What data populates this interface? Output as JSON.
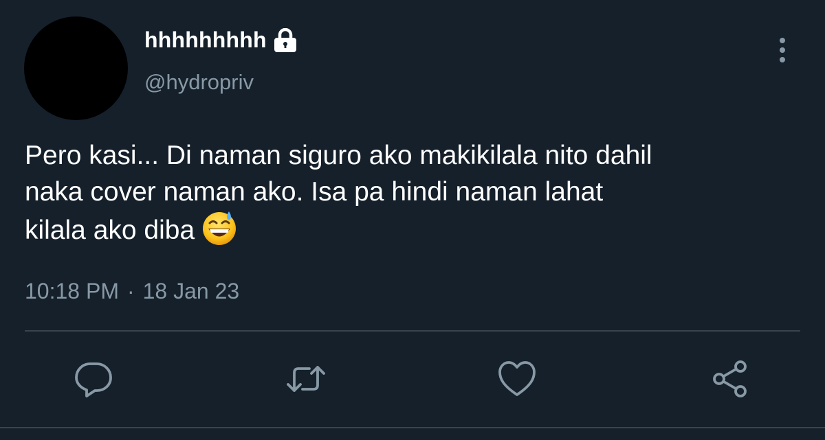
{
  "user": {
    "display_name": "hhhhhhhhh",
    "handle": "@hydropriv",
    "protected_icon": "lock-icon"
  },
  "tweet": {
    "text_lines": [
      "Pero kasi... Di naman siguro ako makikilala nito dahil",
      "naka cover naman ako. Isa pa hindi naman lahat",
      "kilala ako diba"
    ],
    "emoji": "grinning-face-with-sweat-icon",
    "time": "10:18 PM",
    "separator": "·",
    "date": "18 Jan 23"
  },
  "actions": [
    {
      "name": "reply",
      "icon": "reply-icon"
    },
    {
      "name": "retweet",
      "icon": "retweet-icon"
    },
    {
      "name": "like",
      "icon": "heart-icon"
    },
    {
      "name": "share",
      "icon": "share-icon"
    }
  ],
  "colors": {
    "background": "#15202b",
    "primary_text": "#ffffff",
    "secondary_text": "#8899a6",
    "divider": "#38444d"
  }
}
